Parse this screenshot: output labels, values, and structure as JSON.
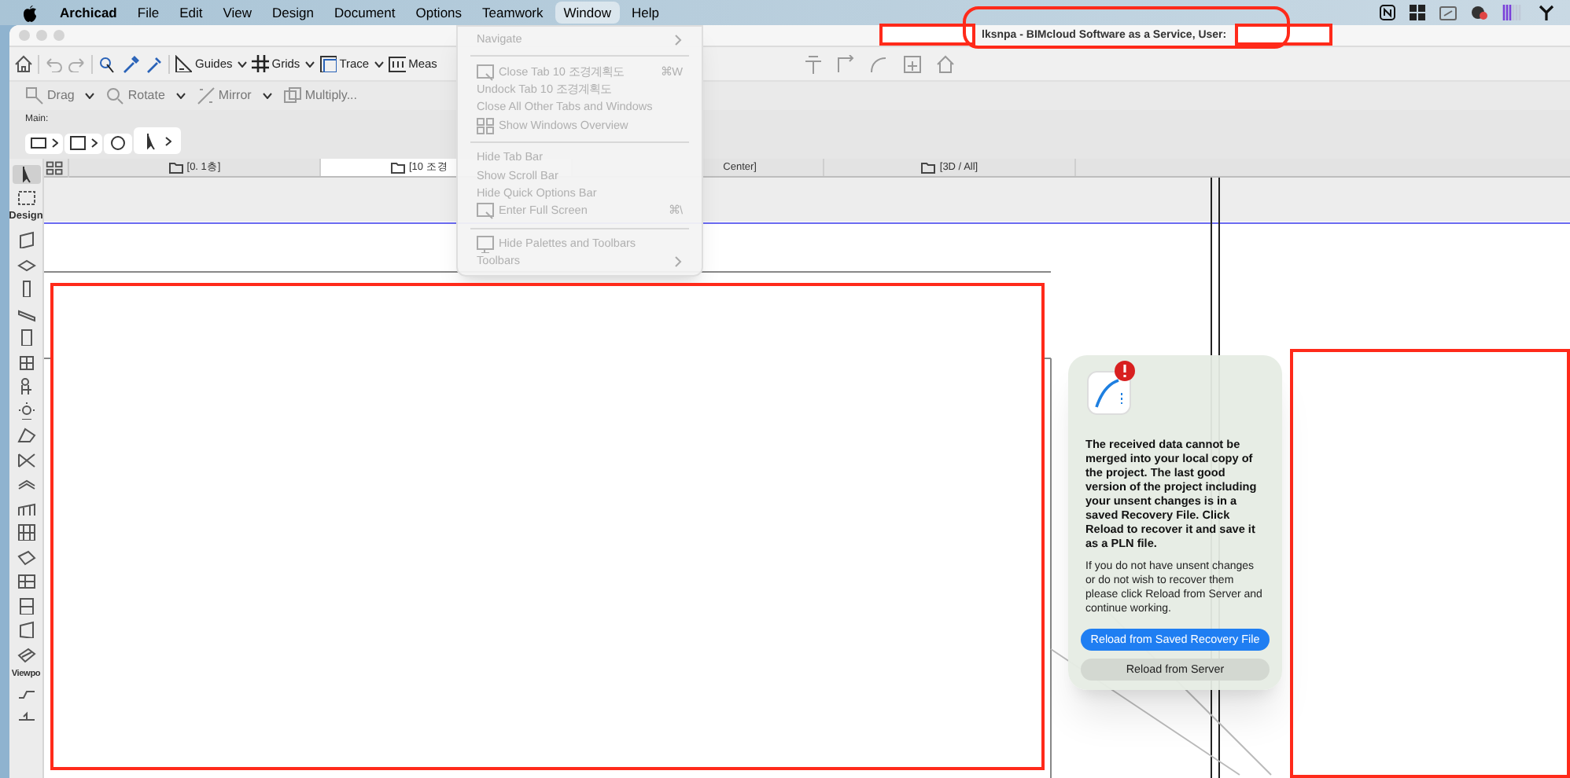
{
  "menu_bar": {
    "items": [
      {
        "label": "Archicad",
        "kind": "app",
        "selected": false
      },
      {
        "label": "File",
        "kind": "menu",
        "selected": false
      },
      {
        "label": "Edit",
        "kind": "menu",
        "selected": false
      },
      {
        "label": "View",
        "kind": "menu",
        "selected": false
      },
      {
        "label": "Design",
        "kind": "menu",
        "selected": false
      },
      {
        "label": "Document",
        "kind": "menu",
        "selected": false
      },
      {
        "label": "Options",
        "kind": "menu",
        "selected": false
      },
      {
        "label": "Teamwork",
        "kind": "menu",
        "selected": false
      },
      {
        "label": "Window",
        "kind": "menu",
        "selected": true
      },
      {
        "label": "Help",
        "kind": "menu",
        "selected": false
      }
    ]
  },
  "window": {
    "title": "lksnpa - BIMcloud Software as a Service, User:"
  },
  "toolbar": {
    "row_1": [
      "Guides",
      "Grids",
      "Trace",
      "Meas"
    ],
    "row_2": [
      "Drag",
      "Rotate",
      "Mirror",
      "Multiply..."
    ],
    "section_label": "Main:"
  },
  "tabs": [
    {
      "label": "[0. 1층]",
      "selected": false
    },
    {
      "label": "[10 조경",
      "selected": true
    },
    {
      "label": "Center]",
      "selected": false
    },
    {
      "label": "[3D / All]",
      "selected": false
    }
  ],
  "toolbox": {
    "sections": [
      "Design",
      "Viewpo"
    ]
  },
  "window_menu": {
    "items": [
      {
        "kind": "item",
        "label": "Navigate",
        "disabled": true,
        "submenu": true
      },
      {
        "kind": "separator"
      },
      {
        "kind": "item",
        "label": "Close Tab 10 조경계획도",
        "disabled": true,
        "shortcut": "⌘W"
      },
      {
        "kind": "item",
        "label": "Undock Tab 10 조경계획도",
        "disabled": true
      },
      {
        "kind": "item",
        "label": "Close All Other Tabs and Windows",
        "disabled": true
      },
      {
        "kind": "item",
        "label": "Show Windows Overview",
        "disabled": true
      },
      {
        "kind": "separator"
      },
      {
        "kind": "item",
        "label": "Hide Tab Bar",
        "disabled": true
      },
      {
        "kind": "item",
        "label": "Show Scroll Bar",
        "disabled": true
      },
      {
        "kind": "item",
        "label": "Hide Quick Options Bar",
        "disabled": true
      },
      {
        "kind": "item",
        "label": "Enter Full Screen",
        "disabled": true,
        "shortcut": "⌘\\"
      },
      {
        "kind": "separator"
      },
      {
        "kind": "item",
        "label": "Hide Palettes and Toolbars",
        "disabled": true
      },
      {
        "kind": "item",
        "label": "Toolbars",
        "disabled": true,
        "submenu": true
      }
    ]
  },
  "dialog": {
    "message": "The received data cannot be merged into your local copy of the project. The last good version of the project including your unsent changes is in a saved Recovery File. Click Reload to recover it and save it as a PLN file.",
    "detail": "If you do not have unsent changes or do not wish to recover them please click Reload from Server and continue working.",
    "buttons": [
      {
        "label": "Reload from Saved Recovery File",
        "kind": "primary"
      },
      {
        "label": "Reload from Server",
        "kind": "secondary"
      }
    ]
  }
}
